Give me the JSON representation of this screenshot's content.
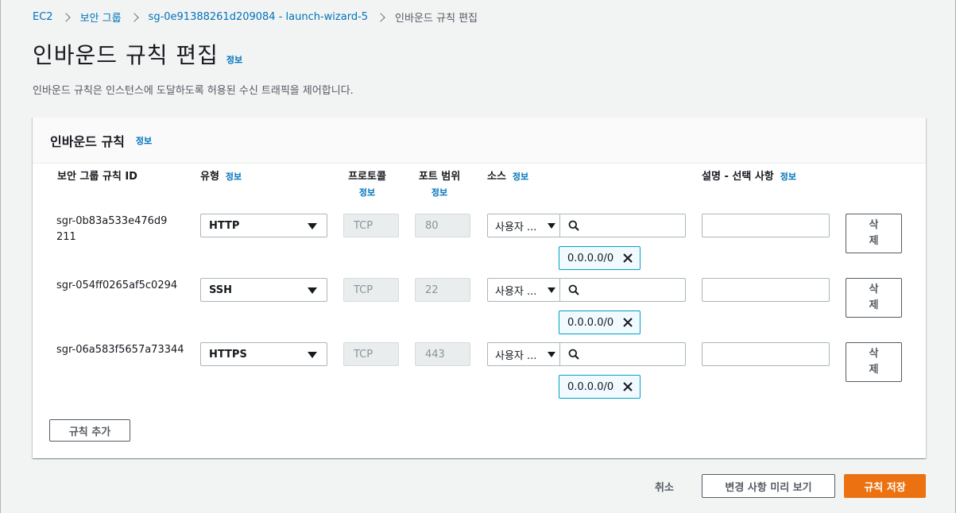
{
  "breadcrumb": [
    "EC2",
    "보안 그룹",
    "sg-0e91388261d209084 - launch-wizard-5",
    "인바운드 규칙 편집"
  ],
  "header": {
    "title": "인바운드 규칙 편집",
    "info": "정보",
    "description": "인바운드 규칙은 인스턴스에 도달하도록 허용된 수신 트래픽을 제어합니다."
  },
  "container": {
    "title": "인바운드 규칙",
    "info": "정보",
    "columns": {
      "rule_id": "보안 그룹 규칙 ID",
      "type": "유형",
      "protocol": "프로토콜",
      "port_range": "포트 범위",
      "source": "소스",
      "description": "설명 - 선택 사항",
      "info": "정보"
    },
    "rules": [
      {
        "id": "sgr-0b83a533e476d9211",
        "type": "HTTP",
        "protocol": "TCP",
        "port": "80",
        "source_type": "사용자 ...",
        "source_value": "0.0.0.0/0",
        "delete": "삭제"
      },
      {
        "id": "sgr-054ff0265af5c0294",
        "type": "SSH",
        "protocol": "TCP",
        "port": "22",
        "source_type": "사용자 ...",
        "source_value": "0.0.0.0/0",
        "delete": "삭제"
      },
      {
        "id": "sgr-06a583f5657a73344",
        "type": "HTTPS",
        "protocol": "TCP",
        "port": "443",
        "source_type": "사용자 ...",
        "source_value": "0.0.0.0/0",
        "delete": "삭제"
      }
    ],
    "add_rule": "규칙 추가"
  },
  "footer": {
    "cancel": "취소",
    "preview": "변경 사항 미리 보기",
    "save": "규칙 저장"
  },
  "colors": {
    "link": "#0073bb",
    "primary": "#ec7211",
    "token_border": "#00a1c9"
  },
  "icons": [
    "chevron-right-icon",
    "search-icon",
    "close-icon",
    "caret-down-icon"
  ]
}
